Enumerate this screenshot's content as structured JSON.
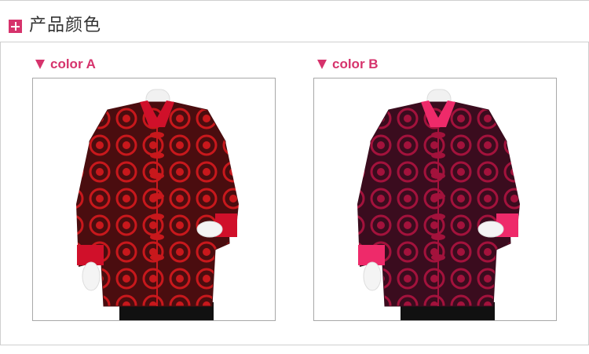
{
  "header": {
    "title": "产品颜色",
    "icon": "plus-icon",
    "accent_color": "#d6336c"
  },
  "variants": [
    {
      "label": "color A",
      "icon": "triangle-down-icon",
      "image": {
        "description_icon": "jacket-photo",
        "jacket_color": "#4a0d0f",
        "pattern_color": "#c8181c",
        "collar_color": "#d0102a"
      }
    },
    {
      "label": "color B",
      "icon": "triangle-down-icon",
      "image": {
        "description_icon": "jacket-photo",
        "jacket_color": "#3a0c1e",
        "pattern_color": "#a3123c",
        "collar_color": "#ee2a6a"
      }
    }
  ]
}
